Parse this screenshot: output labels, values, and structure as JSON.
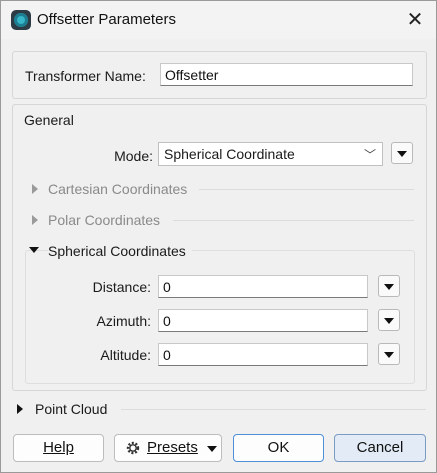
{
  "window": {
    "title": "Offsetter Parameters",
    "icon": "fme-app-icon",
    "close_glyph": "✕"
  },
  "transformer": {
    "label": "Transformer Name:",
    "value": "Offsetter"
  },
  "general": {
    "heading": "General",
    "mode": {
      "label": "Mode:",
      "value": "Spherical Coordinate",
      "chevron": "﹀"
    },
    "sections": {
      "cartesian": "Cartesian Coordinates",
      "polar": "Polar Coordinates",
      "spherical": "Spherical Coordinates"
    },
    "spherical_fields": {
      "distance": {
        "label": "Distance:",
        "value": "0"
      },
      "azimuth": {
        "label": "Azimuth:",
        "value": "0"
      },
      "altitude": {
        "label": "Altitude:",
        "value": "0"
      }
    }
  },
  "point_cloud": {
    "label": "Point Cloud"
  },
  "buttons": {
    "help": "Help",
    "presets": "Presets",
    "ok": "OK",
    "cancel": "Cancel"
  }
}
